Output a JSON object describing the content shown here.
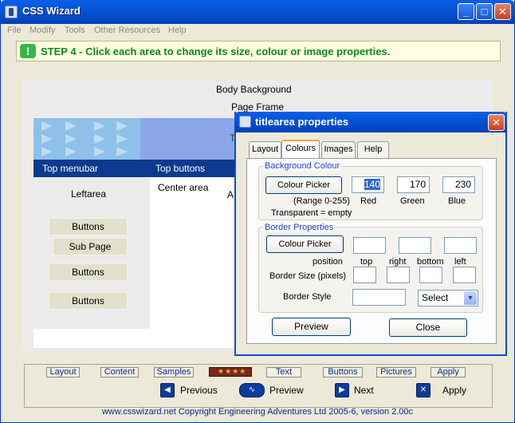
{
  "window": {
    "title": "CSS Wizard"
  },
  "menu": [
    "File",
    "Modify",
    "Tools",
    "Other Resources",
    "Help"
  ],
  "step": {
    "badge": "!",
    "text": "STEP 4 - Click each area to change its size, colour or image properties."
  },
  "canvas": {
    "body_label": "Body Background",
    "frame_label": "Page Frame",
    "title_initial": "T",
    "top_menubar": "Top menubar",
    "top_buttons": "Top buttons",
    "leftarea": "Leftarea",
    "left_buttons": [
      "Buttons",
      "Sub Page",
      "Buttons",
      "Buttons"
    ],
    "center_area": "Center area",
    "center_initial": "A",
    "banner_color": "#8ec0ea"
  },
  "dialog": {
    "title": "titlearea properties",
    "tabs": [
      "Layout",
      "Colours",
      "Images",
      "Help"
    ],
    "active_tab": "Colours",
    "background": {
      "legend": "Background Colour",
      "picker_label": "Colour Picker",
      "red": "140",
      "green": "170",
      "blue": "230",
      "range_note": "(Range 0-255)",
      "transparent_note": "Transparent = empty",
      "red_label": "Red",
      "green_label": "Green",
      "blue_label": "Blue"
    },
    "border": {
      "legend": "Border Properties",
      "picker_label": "Colour Picker",
      "position_label": "position",
      "top_label": "top",
      "right_label": "right",
      "bottom_label": "bottom",
      "left_label": "left",
      "size_label": "Border Size  (pixels)",
      "style_label": "Border Style",
      "style_select": "Select"
    },
    "preview_label": "Preview",
    "close_label": "Close"
  },
  "bottom": {
    "tabs": [
      "Layout",
      "Content",
      "Samples",
      "Text",
      "Buttons",
      "Pictures",
      "Apply"
    ],
    "nav": {
      "previous": "Previous",
      "preview": "Preview",
      "next": "Next",
      "apply": "Apply"
    }
  },
  "footer": "www.csswizard.net Copyright Engineering Adventures Ltd 2005-6,  version 2.00c",
  "colors": {
    "titlebar": "#0553d4",
    "step_text": "#0c8a1a",
    "nav_strip": "#0b3a8e"
  }
}
